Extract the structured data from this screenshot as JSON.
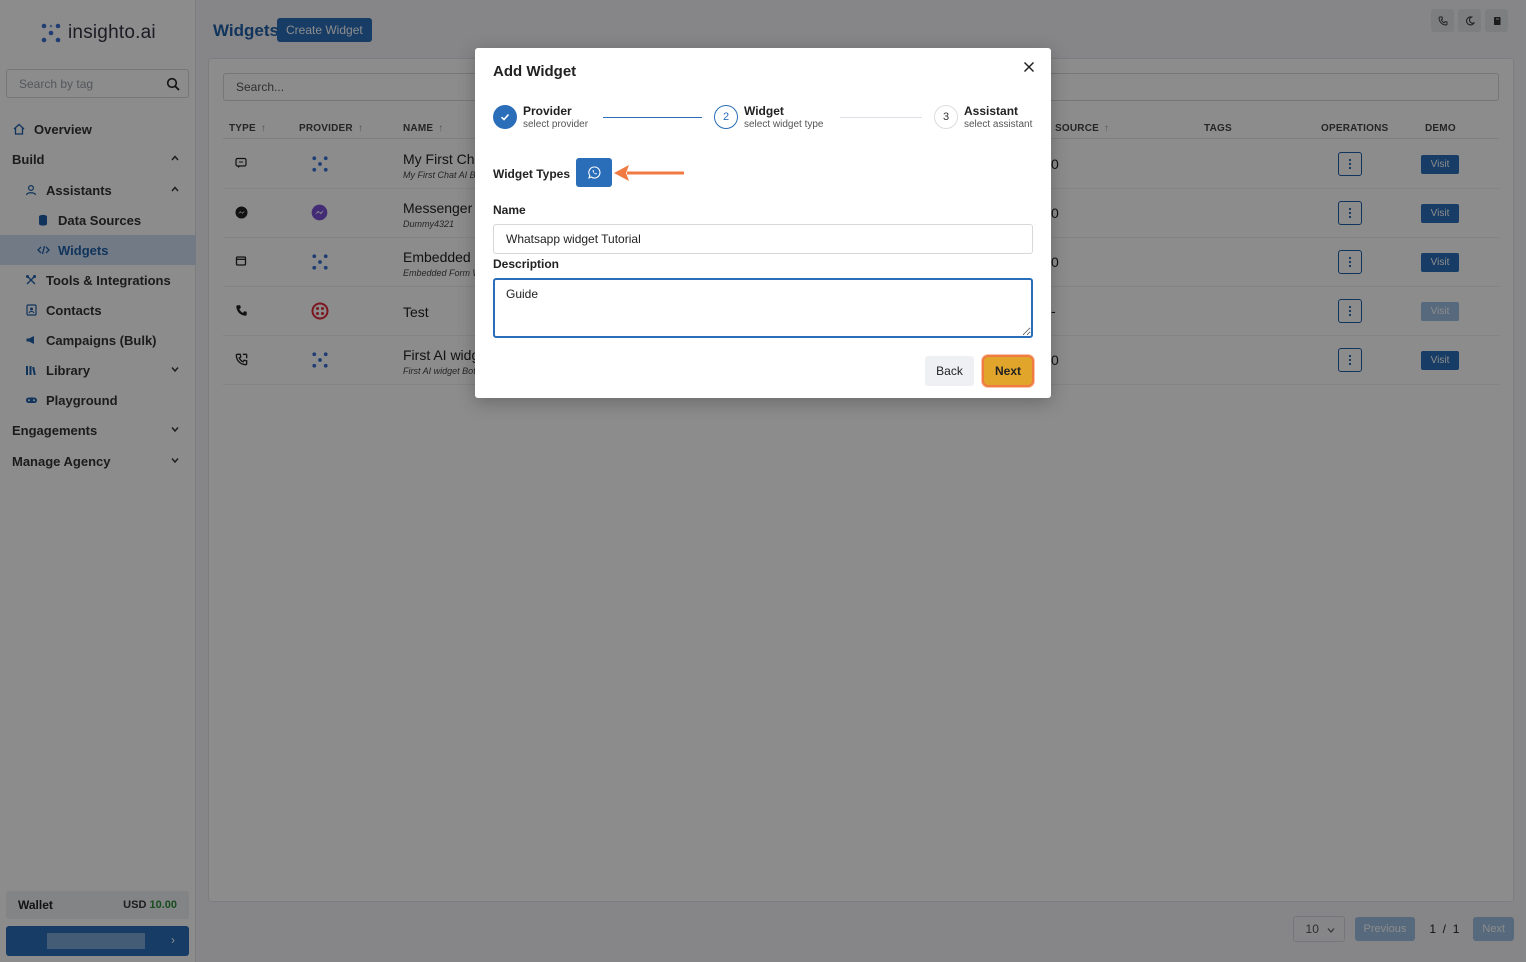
{
  "app": {
    "logo_text": "insighto.ai"
  },
  "sidebar": {
    "search_placeholder": "Search by tag",
    "items": [
      {
        "label": "Overview",
        "icon": "home-icon"
      },
      {
        "label": "Build",
        "icon": ""
      },
      {
        "label": "Assistants",
        "icon": "person-icon"
      },
      {
        "label": "Data Sources",
        "icon": "database-icon"
      },
      {
        "label": "Widgets",
        "icon": "code-icon"
      },
      {
        "label": "Tools & Integrations",
        "icon": "tools-icon"
      },
      {
        "label": "Contacts",
        "icon": "contact-icon"
      },
      {
        "label": "Campaigns (Bulk)",
        "icon": "megaphone-icon"
      },
      {
        "label": "Library",
        "icon": "library-icon"
      },
      {
        "label": "Playground",
        "icon": "gamepad-icon"
      },
      {
        "label": "Engagements",
        "icon": ""
      },
      {
        "label": "Manage Agency",
        "icon": ""
      }
    ],
    "wallet_label": "Wallet",
    "wallet_currency": "USD",
    "wallet_amount": "10.00",
    "user_arrow": "›"
  },
  "main": {
    "title": "Widgets",
    "create_button": "Create Widget",
    "search_placeholder": "Search...",
    "columns": {
      "type": "TYPE",
      "provider": "PROVIDER",
      "name": "NAME",
      "source": "SOURCE",
      "tags": "TAGS",
      "operations": "OPERATIONS",
      "demo": "DEMO"
    },
    "sort_arrow": "↑",
    "rows": [
      {
        "name": "My First Cha",
        "sub": "My First Chat AI Bo",
        "source": "0",
        "visit": "Visit",
        "type_icon": "chat-icon",
        "provider_icon": "insighto-logo-icon"
      },
      {
        "name": "Messenger W",
        "sub": "Dummy4321",
        "source": "0",
        "visit": "Visit",
        "type_icon": "messenger-icon",
        "provider_icon": "messenger-logo-icon"
      },
      {
        "name": "Embedded F",
        "sub": "Embedded Form W",
        "source": "0",
        "visit": "Visit",
        "type_icon": "window-icon",
        "provider_icon": "insighto-logo-icon"
      },
      {
        "name": "Test",
        "sub": "",
        "source": "-",
        "visit": "Visit",
        "type_icon": "phone-icon",
        "provider_icon": "twilio-logo-icon"
      },
      {
        "name": "First AI widg",
        "sub": "First AI widget Bot",
        "source": "0",
        "visit": "Visit",
        "type_icon": "phone-call-icon",
        "provider_icon": "insighto-logo-icon"
      }
    ],
    "pager": {
      "page_size": "10",
      "previous": "Previous",
      "page_info": "1  /  1",
      "next": "Next"
    }
  },
  "modal": {
    "title": "Add Widget",
    "steps": [
      {
        "title": "Provider",
        "desc": "select provider",
        "number": ""
      },
      {
        "title": "Widget",
        "desc": "select widget type",
        "number": "2"
      },
      {
        "title": "Assistant",
        "desc": "select assistant",
        "number": "3"
      }
    ],
    "widget_types_label": "Widget Types",
    "widget_type_icon": "whatsapp-icon",
    "name_label": "Name",
    "name_value": "Whatsapp widget Tutorial",
    "description_label": "Description",
    "description_value": "Guide",
    "back_button": "Back",
    "next_button": "Next"
  },
  "colors": {
    "primary": "#2a6db8",
    "accent_highlight": "#f07a42",
    "next_button": "#e0a52a"
  }
}
